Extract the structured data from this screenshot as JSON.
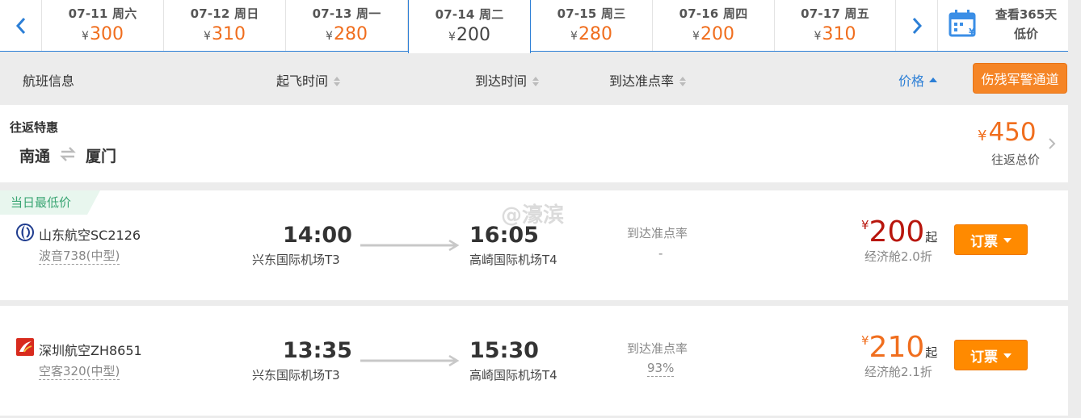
{
  "dates": [
    {
      "label": "07-11 周六",
      "price": "300"
    },
    {
      "label": "07-12 周日",
      "price": "310"
    },
    {
      "label": "07-13 周一",
      "price": "280"
    },
    {
      "label": "07-14 周二",
      "price": "200"
    },
    {
      "label": "07-15 周三",
      "price": "280"
    },
    {
      "label": "07-16 周四",
      "price": "200"
    },
    {
      "label": "07-17 周五",
      "price": "310"
    }
  ],
  "currency_symbol": "¥",
  "calendar": {
    "line1": "查看365天",
    "line2": "低价",
    "icon": "calendar-icon"
  },
  "columns": {
    "flight_info": "航班信息",
    "depart_time": "起飞时间",
    "arrive_time": "到达时间",
    "ontime_rate": "到达准点率",
    "price": "价格"
  },
  "police_channel": "伤残军警通道",
  "round_trip": {
    "title": "往返特惠",
    "from": "南通",
    "to": "厦门",
    "price": "450",
    "price_label": "往返总价"
  },
  "lowest_tag": "当日最低价",
  "watermark": "@濠滨",
  "flights": [
    {
      "airline": "山东航空SC2126",
      "aircraft": "波音738(中型)",
      "depart_time": "14:00",
      "depart_airport": "兴东国际机场T3",
      "arrive_time": "16:05",
      "arrive_airport": "高崎国际机场T4",
      "ontime_label": "到达准点率",
      "ontime_value": "-",
      "price": "200",
      "price_suffix": "起",
      "cabin": "经济舱2.0折",
      "book_label": "订票"
    },
    {
      "airline": "深圳航空ZH8651",
      "aircraft": "空客320(中型)",
      "depart_time": "13:35",
      "depart_airport": "兴东国际机场T3",
      "arrive_time": "15:30",
      "arrive_airport": "高崎国际机场T4",
      "ontime_label": "到达准点率",
      "ontime_value": "93%",
      "price": "210",
      "price_suffix": "起",
      "cabin": "经济舱2.1折",
      "book_label": "订票"
    }
  ],
  "colors": {
    "accent_blue": "#2c7fd6",
    "price_orange": "#f06e1e",
    "price_red": "#b8160d",
    "lowest_green": "#3aa573"
  }
}
